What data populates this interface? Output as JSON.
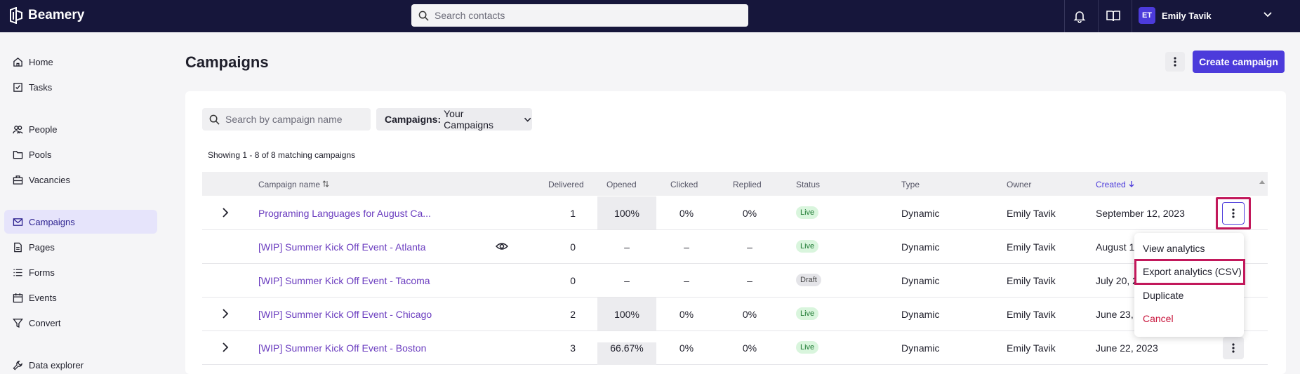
{
  "app": {
    "brand": "Beamery"
  },
  "topbar": {
    "search_placeholder": "Search contacts",
    "user": {
      "initials": "ET",
      "name": "Emily Tavik"
    }
  },
  "sidebar": {
    "items": [
      {
        "label": "Home",
        "icon": "home-icon"
      },
      {
        "label": "Tasks",
        "icon": "tasks-icon"
      },
      {
        "label": "People",
        "icon": "people-icon"
      },
      {
        "label": "Pools",
        "icon": "folder-icon"
      },
      {
        "label": "Vacancies",
        "icon": "briefcase-icon"
      },
      {
        "label": "Campaigns",
        "icon": "mail-icon",
        "active": true
      },
      {
        "label": "Pages",
        "icon": "page-icon"
      },
      {
        "label": "Forms",
        "icon": "list-icon"
      },
      {
        "label": "Events",
        "icon": "calendar-icon"
      },
      {
        "label": "Convert",
        "icon": "funnel-icon"
      },
      {
        "label": "Data explorer",
        "icon": "wrench-icon"
      }
    ]
  },
  "page": {
    "title": "Campaigns",
    "create_button": "Create campaign",
    "search_placeholder": "Search by campaign name",
    "filter": {
      "label": "Campaigns:",
      "value": "Your Campaigns"
    },
    "showing": "Showing 1 - 8 of 8 matching campaigns"
  },
  "table": {
    "headers": {
      "name": "Campaign name",
      "delivered": "Delivered",
      "opened": "Opened",
      "clicked": "Clicked",
      "replied": "Replied",
      "status": "Status",
      "type": "Type",
      "owner": "Owner",
      "created": "Created"
    },
    "rows": [
      {
        "name": "Programing Languages for August Ca...",
        "delivered": "1",
        "opened": "100%",
        "clicked": "0%",
        "replied": "0%",
        "status": "Live",
        "type": "Dynamic",
        "owner": "Emily Tavik",
        "created": "September 12, 2023",
        "expandable": true
      },
      {
        "name": "[WIP] Summer Kick Off Event - Atlanta",
        "delivered": "0",
        "opened": "–",
        "clicked": "–",
        "replied": "–",
        "status": "Live",
        "type": "Dynamic",
        "owner": "Emily Tavik",
        "created": "August 1",
        "expandable": false
      },
      {
        "name": "[WIP] Summer Kick Off Event - Tacoma",
        "delivered": "0",
        "opened": "–",
        "clicked": "–",
        "replied": "–",
        "status": "Draft",
        "type": "Dynamic",
        "owner": "Emily Tavik",
        "created": "July 20, 2",
        "expandable": false
      },
      {
        "name": "[WIP] Summer Kick Off Event - Chicago",
        "delivered": "2",
        "opened": "100%",
        "clicked": "0%",
        "replied": "0%",
        "status": "Live",
        "type": "Dynamic",
        "owner": "Emily Tavik",
        "created": "June 23,",
        "expandable": true
      },
      {
        "name": "[WIP] Summer Kick Off Event - Boston",
        "delivered": "3",
        "opened": "66.67%",
        "clicked": "0%",
        "replied": "0%",
        "status": "Live",
        "type": "Dynamic",
        "owner": "Emily Tavik",
        "created": "June 22, 2023",
        "expandable": true
      }
    ]
  },
  "menu": {
    "items": [
      "View analytics",
      "Export analytics (CSV)",
      "Duplicate",
      "Cancel"
    ]
  },
  "colors": {
    "accent": "#4c3bdb",
    "topbar": "#16163b",
    "highlight": "#c2185b",
    "link": "#6a3cbf",
    "cancel": "#c8163d"
  }
}
